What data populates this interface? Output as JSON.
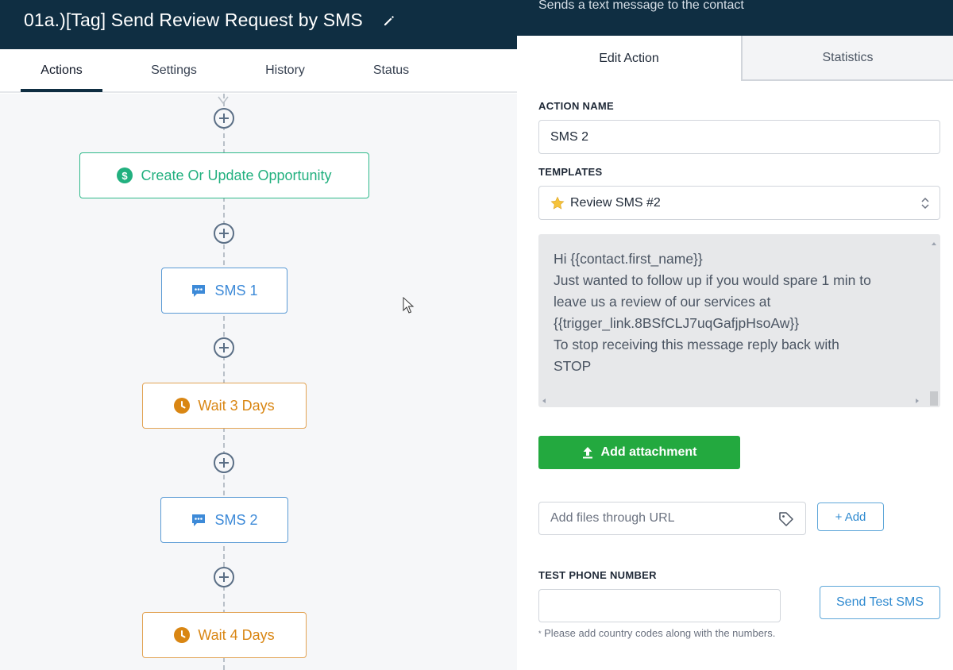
{
  "header": {
    "title": "01a.)[Tag] Send Review Request by SMS",
    "right_subtitle": "Sends a text message to the contact"
  },
  "tabs": [
    {
      "label": "Actions",
      "active": true
    },
    {
      "label": "Settings",
      "active": false
    },
    {
      "label": "History",
      "active": false
    },
    {
      "label": "Status",
      "active": false
    }
  ],
  "workflow": {
    "nodes": [
      {
        "label": "Create Or Update Opportunity",
        "icon": "dollar-icon",
        "color": "#22b07f"
      },
      {
        "label": "SMS 1",
        "icon": "chat-icon",
        "color": "#3d8ad8"
      },
      {
        "label": "Wait 3 Days",
        "icon": "clock-icon",
        "color": "#d98613"
      },
      {
        "label": "SMS 2",
        "icon": "chat-icon",
        "color": "#3d8ad8"
      },
      {
        "label": "Wait 4 Days",
        "icon": "clock-icon",
        "color": "#d98613"
      }
    ]
  },
  "panel": {
    "tabs": {
      "edit": "Edit Action",
      "stats": "Statistics"
    },
    "action_name_label": "ACTION NAME",
    "action_name_value": "SMS 2",
    "templates_label": "TEMPLATES",
    "template_selected": "Review SMS #2",
    "message_lines": [
      "Hi {{contact.first_name}}",
      "Just wanted to follow up if you would spare 1 min to",
      "leave us a review of our services at",
      "{{trigger_link.8BSfCLJ7uqGafjpHsoAw}}",
      "To stop receiving this message reply back with",
      "STOP"
    ],
    "add_attachment": "Add attachment",
    "url_placeholder": "Add files through URL",
    "add_button": "+ Add",
    "test_phone_label": "TEST PHONE NUMBER",
    "test_phone_value": "",
    "send_test_button": "Send Test SMS",
    "hint": "Please add country codes along with the numbers."
  },
  "colors": {
    "header_bg": "#0f2e42",
    "accent_green": "#23a93f",
    "link_blue": "#2f8ad0"
  }
}
